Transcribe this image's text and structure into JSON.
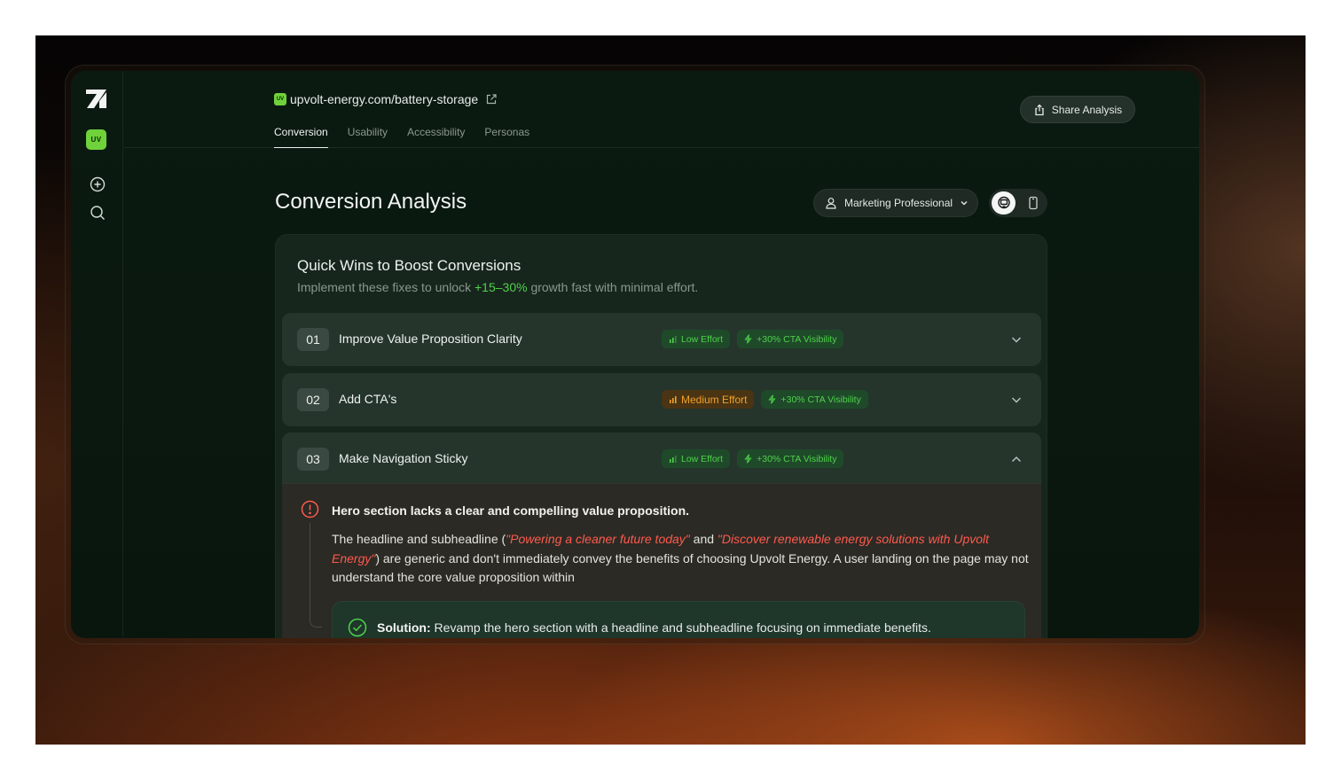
{
  "site": {
    "badge": "UV",
    "url": "upvolt-energy.com/battery-storage"
  },
  "tabs": [
    {
      "label": "Conversion",
      "active": true
    },
    {
      "label": "Usability",
      "active": false
    },
    {
      "label": "Accessibility",
      "active": false
    },
    {
      "label": "Personas",
      "active": false
    }
  ],
  "share_label": "Share Analysis",
  "page_title": "Conversion Analysis",
  "persona": {
    "selected": "Marketing Professional"
  },
  "device": {
    "selected": "desktop"
  },
  "quick_wins": {
    "title": "Quick Wins to Boost Conversions",
    "subtitle_before": "Implement these fixes to unlock ",
    "subtitle_highlight": "+15–30%",
    "subtitle_after": " growth fast with minimal effort.",
    "items": [
      {
        "num": "01",
        "title": "Improve Value Proposition Clarity",
        "effort": "Low Effort",
        "impact": "+30% CTA Visibility",
        "expanded": false
      },
      {
        "num": "02",
        "title": "Add CTA's",
        "effort": "Medium Effort",
        "impact": "+30% CTA Visibility",
        "expanded": false
      },
      {
        "num": "03",
        "title": "Make Navigation Sticky",
        "effort": "Low Effort",
        "impact": "+30% CTA Visibility",
        "expanded": true
      }
    ]
  },
  "issue": {
    "title": "Hero section lacks a clear and compelling value proposition.",
    "body_1": "The headline and subheadline (",
    "quote_1": "\"Powering a cleaner future today\"",
    "body_2": " and ",
    "quote_2": "\"Discover renewable energy solutions with Upvolt Energy\"",
    "body_3": ") are generic and don't immediately convey the benefits of choosing Upvolt Energy. A user landing on the page may not understand the core value proposition within",
    "solution_label": "Solution:",
    "solution_text": " Revamp the hero section with a headline and subheadline focusing on immediate benefits."
  },
  "colors": {
    "accent_green": "#4fd14a",
    "brand_green": "#6fd23a",
    "warning_orange": "#f0a22b",
    "error_red": "#ff5a4d"
  }
}
